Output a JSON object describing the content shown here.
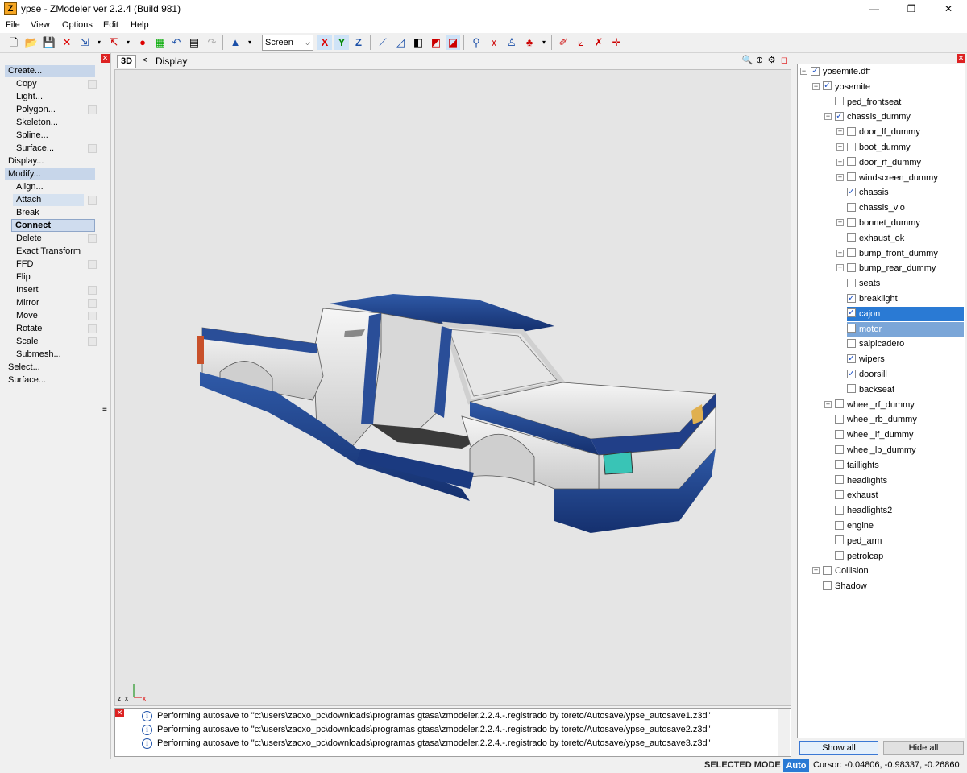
{
  "window": {
    "title": "ypse - ZModeler ver 2.2.4 (Build 981)",
    "app_icon_letter": "Z",
    "controls": [
      "—",
      "❐",
      "✕"
    ]
  },
  "menu": [
    "File",
    "View",
    "Options",
    "Edit",
    "Help"
  ],
  "toolbar": {
    "space_select": "Screen",
    "axis_x": "X",
    "axis_y": "Y",
    "axis_z": "Z"
  },
  "left_panel": {
    "items": [
      {
        "label": "Create...",
        "level": 0,
        "style": "hdr"
      },
      {
        "label": "Copy",
        "level": 1,
        "box": true
      },
      {
        "label": "Light...",
        "level": 1
      },
      {
        "label": "Polygon...",
        "level": 1,
        "box": true
      },
      {
        "label": "Skeleton...",
        "level": 1
      },
      {
        "label": "Spline...",
        "level": 1
      },
      {
        "label": "Surface...",
        "level": 1,
        "box": true
      },
      {
        "label": "Display...",
        "level": 0
      },
      {
        "label": "Modify...",
        "level": 0,
        "style": "hdr"
      },
      {
        "label": "Align...",
        "level": 1
      },
      {
        "label": "Attach",
        "level": 1,
        "box": true,
        "style": "attach"
      },
      {
        "label": "Break",
        "level": 1
      },
      {
        "label": "Connect",
        "level": 1,
        "style": "connect"
      },
      {
        "label": "Delete",
        "level": 1,
        "box": true
      },
      {
        "label": "Exact Transform",
        "level": 1
      },
      {
        "label": "FFD",
        "level": 1,
        "box": true
      },
      {
        "label": "Flip",
        "level": 1
      },
      {
        "label": "Insert",
        "level": 1,
        "box": true
      },
      {
        "label": "Mirror",
        "level": 1,
        "box": true
      },
      {
        "label": "Move",
        "level": 1,
        "box": true
      },
      {
        "label": "Rotate",
        "level": 1,
        "box": true
      },
      {
        "label": "Scale",
        "level": 1,
        "box": true
      },
      {
        "label": "Submesh...",
        "level": 1
      },
      {
        "label": "Select...",
        "level": 0
      },
      {
        "label": "Surface...",
        "level": 0
      }
    ]
  },
  "viewport": {
    "mode_button": "3D",
    "back": "<",
    "label": "Display"
  },
  "log": {
    "entries": [
      "Performing autosave to \"c:\\users\\zacxo_pc\\downloads\\programas gtasa\\zmodeler.2.2.4.-.registrado by toreto/Autosave/ypse_autosave1.z3d\"",
      "Performing autosave to \"c:\\users\\zacxo_pc\\downloads\\programas gtasa\\zmodeler.2.2.4.-.registrado by toreto/Autosave/ypse_autosave2.z3d\"",
      "Performing autosave to \"c:\\users\\zacxo_pc\\downloads\\programas gtasa\\zmodeler.2.2.4.-.registrado by toreto/Autosave/ypse_autosave3.z3d\""
    ]
  },
  "tree": {
    "nodes": [
      {
        "label": "yosemite.dff",
        "depth": 0,
        "checked": true,
        "expander": "minus"
      },
      {
        "label": "yosemite",
        "depth": 1,
        "checked": true,
        "expander": "minus"
      },
      {
        "label": "ped_frontseat",
        "depth": 2,
        "checked": false
      },
      {
        "label": "chassis_dummy",
        "depth": 2,
        "checked": true,
        "expander": "minus"
      },
      {
        "label": "door_lf_dummy",
        "depth": 3,
        "checked": false,
        "expander": "plus"
      },
      {
        "label": "boot_dummy",
        "depth": 3,
        "checked": false,
        "expander": "plus"
      },
      {
        "label": "door_rf_dummy",
        "depth": 3,
        "checked": false,
        "expander": "plus"
      },
      {
        "label": "windscreen_dummy",
        "depth": 3,
        "checked": false,
        "expander": "plus"
      },
      {
        "label": "chassis",
        "depth": 3,
        "checked": true
      },
      {
        "label": "chassis_vlo",
        "depth": 3,
        "checked": false
      },
      {
        "label": "bonnet_dummy",
        "depth": 3,
        "checked": false,
        "expander": "plus"
      },
      {
        "label": "exhaust_ok",
        "depth": 3,
        "checked": false
      },
      {
        "label": "bump_front_dummy",
        "depth": 3,
        "checked": false,
        "expander": "plus"
      },
      {
        "label": "bump_rear_dummy",
        "depth": 3,
        "checked": false,
        "expander": "plus"
      },
      {
        "label": "seats",
        "depth": 3,
        "checked": false
      },
      {
        "label": "breaklight",
        "depth": 3,
        "checked": true
      },
      {
        "label": "cajon",
        "depth": 3,
        "checked": true,
        "highlight": "dark"
      },
      {
        "label": "motor",
        "depth": 3,
        "checked": false,
        "highlight": "light"
      },
      {
        "label": "salpicadero",
        "depth": 3,
        "checked": false
      },
      {
        "label": "wipers",
        "depth": 3,
        "checked": true
      },
      {
        "label": "doorsill",
        "depth": 3,
        "checked": true
      },
      {
        "label": "backseat",
        "depth": 3,
        "checked": false
      },
      {
        "label": "wheel_rf_dummy",
        "depth": 2,
        "checked": false,
        "expander": "plus"
      },
      {
        "label": "wheel_rb_dummy",
        "depth": 2,
        "checked": false
      },
      {
        "label": "wheel_lf_dummy",
        "depth": 2,
        "checked": false
      },
      {
        "label": "wheel_lb_dummy",
        "depth": 2,
        "checked": false
      },
      {
        "label": "taillights",
        "depth": 2,
        "checked": false
      },
      {
        "label": "headlights",
        "depth": 2,
        "checked": false
      },
      {
        "label": "exhaust",
        "depth": 2,
        "checked": false
      },
      {
        "label": "headlights2",
        "depth": 2,
        "checked": false
      },
      {
        "label": "engine",
        "depth": 2,
        "checked": false
      },
      {
        "label": "ped_arm",
        "depth": 2,
        "checked": false
      },
      {
        "label": "petrolcap",
        "depth": 2,
        "checked": false
      },
      {
        "label": "Collision",
        "depth": 1,
        "checked": false,
        "expander": "plus"
      },
      {
        "label": "Shadow",
        "depth": 1,
        "checked": false
      }
    ],
    "show_all": "Show all",
    "hide_all": "Hide all"
  },
  "status": {
    "mode": "SELECTED MODE",
    "auto": "Auto",
    "cursor": "Cursor: -0.04806, -0.98337, -0.26860"
  },
  "colors": {
    "selection": "#2a7ad4",
    "truck_blue": "#1f3f86",
    "truck_white": "#e8e8e8"
  }
}
